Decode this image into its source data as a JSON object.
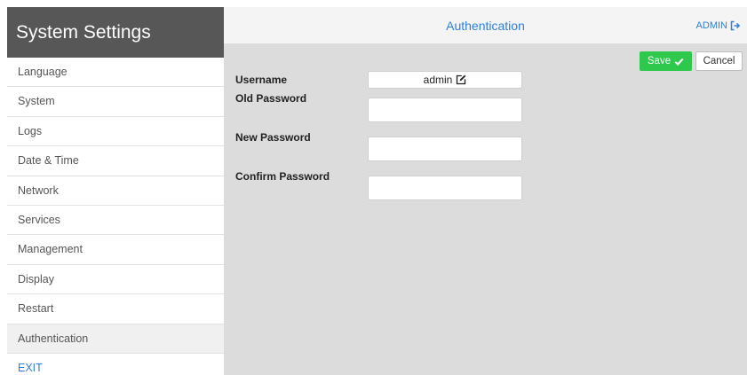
{
  "sidebar": {
    "title": "System Settings",
    "items": [
      {
        "label": "Language"
      },
      {
        "label": "System"
      },
      {
        "label": "Logs"
      },
      {
        "label": "Date & Time"
      },
      {
        "label": "Network"
      },
      {
        "label": "Services"
      },
      {
        "label": "Management"
      },
      {
        "label": "Display"
      },
      {
        "label": "Restart"
      },
      {
        "label": "Authentication"
      },
      {
        "label": "EXIT"
      }
    ]
  },
  "header": {
    "title": "Authentication",
    "user_label": "ADMIN"
  },
  "actions": {
    "save_label": "Save",
    "cancel_label": "Cancel"
  },
  "form": {
    "username_label": "Username",
    "username_value": "admin",
    "old_password_label": "Old Password",
    "new_password_label": "New Password",
    "confirm_password_label": "Confirm Password",
    "old_password_value": "",
    "new_password_value": "",
    "confirm_password_value": ""
  },
  "colors": {
    "accent": "#2f80d8",
    "save": "#2ec84d",
    "sidebar_header": "#575757",
    "content_bg": "#dcdcdc"
  },
  "icons": {
    "admin": "logout-icon",
    "save": "check-icon",
    "username": "edit-icon"
  }
}
